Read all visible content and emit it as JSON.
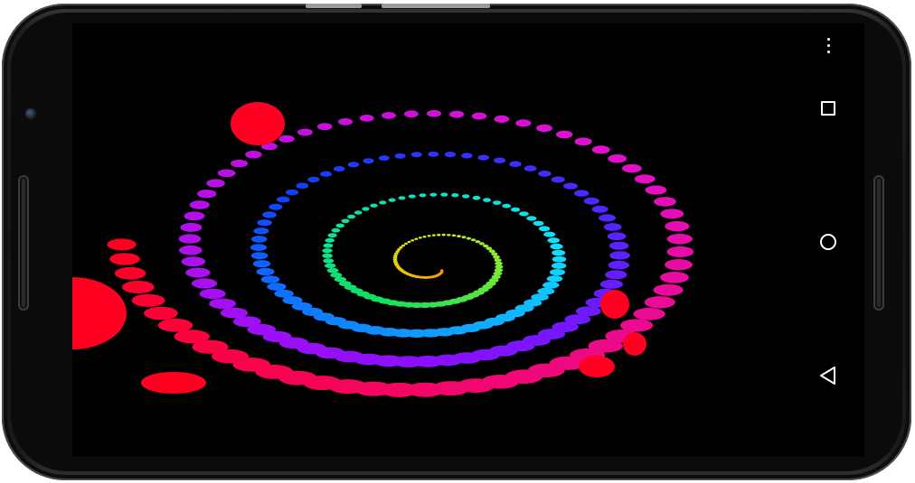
{
  "device": {
    "model": "phone-landscape"
  },
  "app": {
    "content": "spiral-dot-animation",
    "colors": {
      "background": "#000000",
      "outer_ring": "#ff0022",
      "magenta_ring": "#e010d0",
      "violet_ring": "#8a10ff",
      "blue_ring": "#1040ff",
      "cyan_ring": "#10e0ff",
      "green_ring": "#10e060",
      "yellow_ring": "#e0f010",
      "core": "#ff8a00"
    }
  },
  "navigation_bar": {
    "overflow_icon": "overflow-menu-icon",
    "recents_icon": "recents-square-icon",
    "home_icon": "home-circle-icon",
    "back_icon": "back-triangle-icon",
    "icon_color": "#ffffff"
  }
}
